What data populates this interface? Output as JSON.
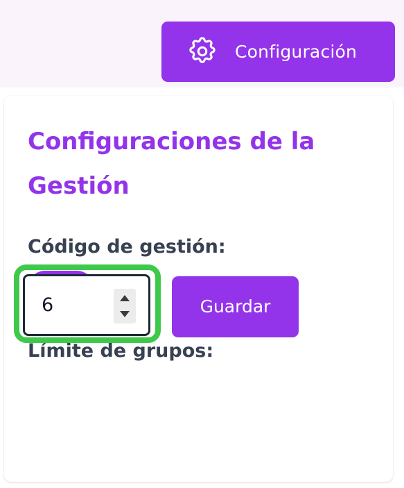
{
  "header": {
    "config_button_label": "Configuración",
    "config_button_icon": "gear-icon"
  },
  "card": {
    "title": "Configuraciones de la Gestión",
    "code_label": "Código de gestión:",
    "code_toggle_on": true,
    "limit_label": "Límite de grupos:",
    "limit_value": "6",
    "save_label": "Guardar"
  },
  "colors": {
    "accent": "#9333ea",
    "focus_ring": "#3ec94b",
    "label_text": "#374151",
    "top_band": "#faf3fc"
  }
}
